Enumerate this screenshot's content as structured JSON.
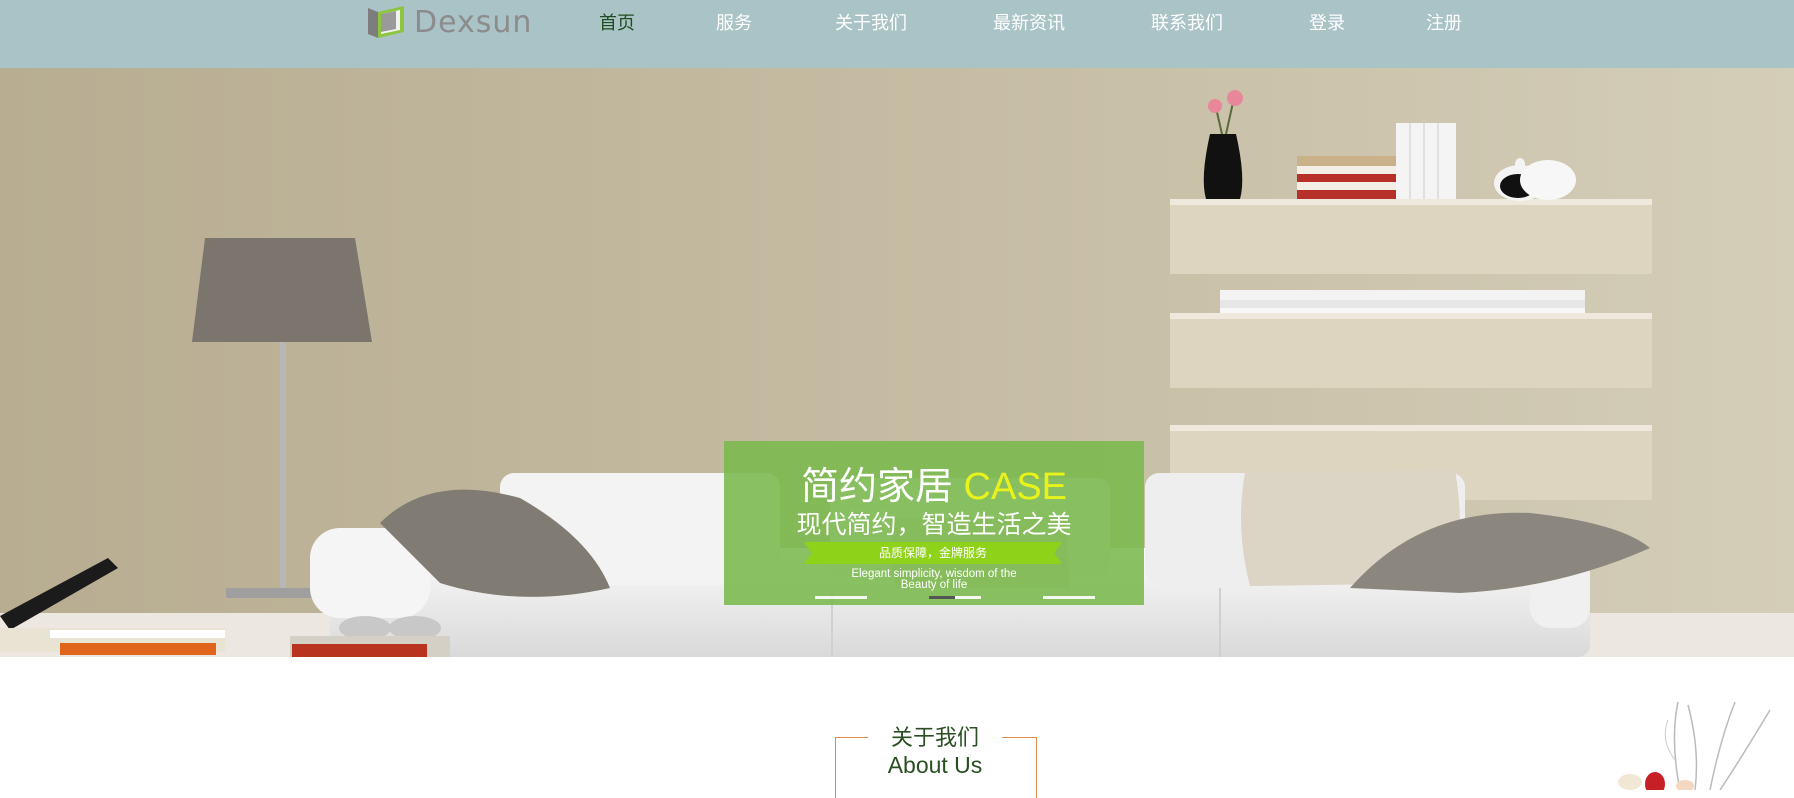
{
  "brand": {
    "name": "Dexsun"
  },
  "nav": {
    "items": [
      {
        "label": "首页",
        "active": true
      },
      {
        "label": "服务",
        "active": false
      },
      {
        "label": "关于我们",
        "active": false
      },
      {
        "label": "最新资讯",
        "active": false
      },
      {
        "label": "联系我们",
        "active": false
      },
      {
        "label": "登录",
        "active": false
      },
      {
        "label": "注册",
        "active": false
      }
    ]
  },
  "hero": {
    "title_cn": "简约家居",
    "title_en": "CASE",
    "subtitle": "现代简约，智造生活之美",
    "ribbon": "品质保障，金牌服务",
    "english_line1": "Elegant simplicity, wisdom of the",
    "english_line2": "Beauty of life",
    "slide_count": 3,
    "active_slide": 2
  },
  "about": {
    "title_cn": "关于我们",
    "title_en": "About Us"
  },
  "colors": {
    "header_bg": "#a9c3c6",
    "nav_active": "#1e4d1e",
    "banner_bg": "#7ab84c",
    "accent_yellow": "#e8f31c",
    "ribbon_green": "#8fd21a",
    "about_border": "#e08a4c",
    "about_text": "#2a4f23"
  }
}
